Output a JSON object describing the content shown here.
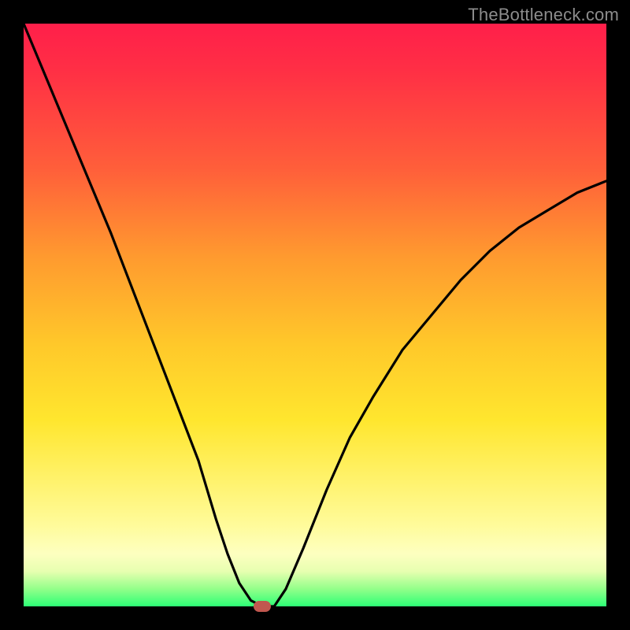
{
  "watermark": "TheBottleneck.com",
  "colors": {
    "frame": "#000000",
    "curve": "#000000",
    "marker": "#c1574f",
    "gradient_top": "#ff1f4a",
    "gradient_bottom": "#2dff76"
  },
  "chart_data": {
    "type": "line",
    "title": "",
    "xlabel": "",
    "ylabel": "",
    "xlim": [
      0,
      100
    ],
    "ylim": [
      0,
      100
    ],
    "note": "No axis ticks or labels visible; values are estimated in percent of plot area (0 = left/bottom, 100 = right/top).",
    "series": [
      {
        "name": "curve",
        "x": [
          0,
          5,
          10,
          15,
          20,
          25,
          30,
          33,
          35,
          37,
          39,
          41,
          43,
          45,
          48,
          52,
          56,
          60,
          65,
          70,
          75,
          80,
          85,
          90,
          95,
          100
        ],
        "y": [
          100,
          88,
          76,
          64,
          51,
          38,
          25,
          15,
          9,
          4,
          1,
          0,
          0,
          3,
          10,
          20,
          29,
          36,
          44,
          50,
          56,
          61,
          65,
          68,
          71,
          73
        ]
      }
    ],
    "marker": {
      "x": 41,
      "y": 0
    },
    "flat_bottom": {
      "x_start": 39,
      "x_end": 43,
      "y": 0
    }
  }
}
